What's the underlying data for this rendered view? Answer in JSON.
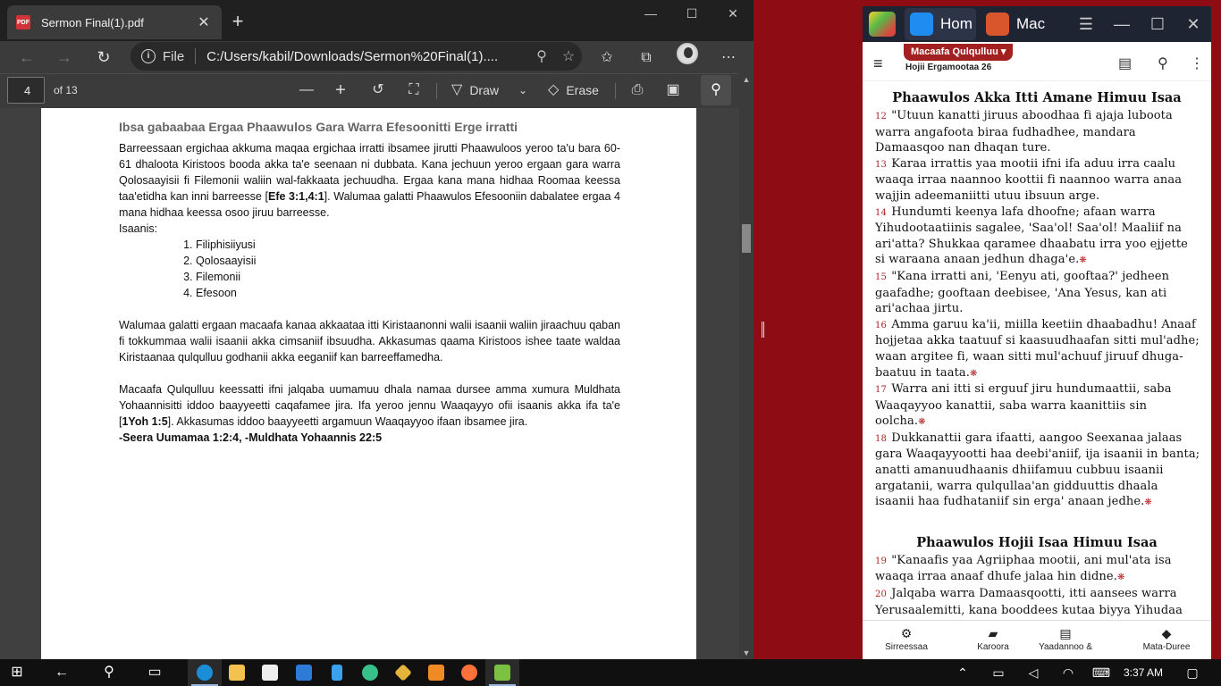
{
  "edge": {
    "tab_title": "Sermon Final(1).pdf",
    "pdf_favicon": "PDF",
    "url_scheme": "File",
    "url": "C:/Users/kabil/Downloads/Sermon%20Final(1)....",
    "page_number": "4",
    "page_of": "of 13",
    "draw_label": "Draw",
    "erase_label": "Erase"
  },
  "pdf": {
    "heading": "Ibsa gabaabaa Ergaa Phaawulos Gara Warra Efesoonitti Erge irratti",
    "para1_a": "Barreessaan ergichaa akkuma maqaa ergichaa irratti ibsamee jirutti Phaawuloos yeroo ta'u bara 60-61 dhaloota Kiristoos booda akka ta'e seenaan ni dubbata. Kana jechuun yeroo ergaan gara warra Qolosaayisii fi Filemonii waliin wal-fakkaata jechuudha. Ergaa kana mana hidhaa Roomaa keessa taa'etidha kan inni barreesse [",
    "para1_ref": "Efe 3:1,4:1",
    "para1_b": "]. Walumaa galatti Phaawulos Efesooniin dabalatee ergaa 4 mana hidhaa keessa osoo jiruu barreesse.",
    "list_intro": "Isaanis:",
    "list": [
      "Filiphisiiyusi",
      "Qolosaayisii",
      "Filemonii",
      "Efesoon"
    ],
    "para2": "Walumaa galatti ergaan macaafa kanaa akkaataa itti Kiristaanonni walii isaanii waliin jiraachuu qaban fi tokkummaa walii isaanii akka cimsaniif ibsuudha. Akkasumas qaama Kiristoos ishee taate waldaa Kiristaanaa qulqulluu godhanii akka eeganiif kan barreeffamedha.",
    "para3_a": "Macaafa Qulqulluu keessatti ifni jalqaba uumamuu dhala namaa dursee amma xumura Muldhata Yohaannisitti iddoo baayyeetti caqafamee jira. Ifa yeroo jennu Waaqayyo ofii isaanis akka ifa ta'e [",
    "para3_ref": "1Yoh 1:5",
    "para3_b": "]. Akkasumas iddoo baayyeetti argamuun Waaqayyoo ifaan ibsamee jira.",
    "para3_refs": "-Seera Uumamaa 1:2:4, -Muldhata Yohaannis 22:5"
  },
  "bluestacks": {
    "tab1_label": "Hom",
    "tab2_label": "Mac",
    "book_badge": "Macaafa Qulqulluu ▾",
    "chapter_label": "Hojii Ergamootaa  26",
    "section1_title": "Phaawulos Akka Itti Amane Himuu Isaa",
    "section2_title": "Phaawulos Hojii Isaa Himuu Isaa",
    "footnote_mark": "❋",
    "verses1": [
      {
        "n": "12",
        "text": "\"Utuun kanatti jiruus aboodhaa fi ajaja luboota warra angafoota biraa fudhadhee, mandara Damaasqoo nan dhaqan ture.",
        "fn": false
      },
      {
        "n": "13",
        "text": "Karaa irrattis yaa mootii ifni ifa aduu irra caalu waaqa irraa naannoo koottii fi naannoo warra anaa wajjin adeemaniitti utuu ibsuun arge.",
        "fn": false
      },
      {
        "n": "14",
        "text": "Hundumti keenya lafa dhoofne; afaan warra Yihudootaatiinis sagalee, 'Saa'ol! Saa'ol! Maaliif na ari'atta? Shukkaa qaramee dhaabatu irra yoo ejjette si waraana anaan jedhun dhaga'e.",
        "fn": true
      },
      {
        "n": "15",
        "text": "\"Kana irratti ani, 'Eenyu ati, gooftaa?' jedheen gaafadhe; gooftaan deebisee, 'Ana Yesus, kan ati ari'achaa jirtu.",
        "fn": false
      },
      {
        "n": "16",
        "text": "Amma garuu ka'ii, miilla keetiin dhaabadhu! Anaaf hojjetaa akka taatuuf si kaasuudhaafan sitti mul'adhe; waan argitee fi, waan sitti mul'achuuf jiruuf dhuga-baatuu in taata.",
        "fn": true
      },
      {
        "n": "17",
        "text": "Warra ani itti si erguuf jiru hundumaattii, saba Waaqayyoo kanattii, saba warra kaanittiis sin oolcha.",
        "fn": true
      },
      {
        "n": "18",
        "text": "Dukkanattii gara ifaatti, aangoo Seexanaa jalaas gara Waaqayyootti haa deebi'aniif, ija isaanii in banta; anatti amanuudhaanis dhiifamuu cubbuu isaanii argatanii, warra qulqullaa'an gidduuttis dhaala isaanii haa fudhataniif sin erga' anaan jedhe.",
        "fn": true
      }
    ],
    "verses2": [
      {
        "n": "19",
        "text": "\"Kanaafis yaa Agriiphaa mootii, ani mul'ata isa waaqa irraa anaaf dhufe jalaa hin didne.",
        "fn": true
      },
      {
        "n": "20",
        "text": "Jalqaba warra Damaasqootti, itti aansees warra Yerusaalemitti, kana booddees kutaa biyya Yihudaa hundumaatti, warra saba Waaqayyoo hin ta'inittis",
        "fn": false
      }
    ],
    "nav": [
      "Sirreessaa",
      "Karoora",
      "Yaadannoo &",
      "Mata-Duree"
    ]
  },
  "taskbar": {
    "clock": "3:37 AM"
  },
  "colors": {
    "desktop": "#8e0c14",
    "accent_red": "#b22222",
    "edge_dark": "#3b3b3b"
  }
}
